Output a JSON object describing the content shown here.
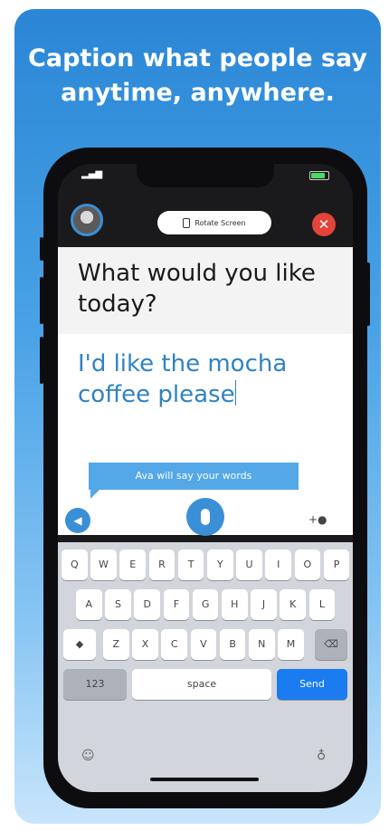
{
  "headline": {
    "line1": "Caption what people say",
    "line2": "anytime, anywhere."
  },
  "app": {
    "rotate_label": "Rotate Screen",
    "close_label": "✕",
    "question_text": "What would you like today?",
    "answer_text": "I'd like the mocha coffee please",
    "tooltip": "Ava will say your words"
  },
  "keyboard": {
    "row1": [
      "Q",
      "W",
      "E",
      "R",
      "T",
      "Y",
      "U",
      "I",
      "O",
      "P"
    ],
    "row2": [
      "A",
      "S",
      "D",
      "F",
      "G",
      "H",
      "J",
      "K",
      "L"
    ],
    "row3": [
      "Z",
      "X",
      "C",
      "V",
      "B",
      "N",
      "M"
    ],
    "numbers_label": "123",
    "space_label": "space",
    "send_label": "Send"
  },
  "icons": {
    "shift": "shift-icon",
    "backspace": "backspace-icon",
    "emoji": "emoji-icon",
    "dictation": "microphone-icon",
    "speaker": "speaker-icon",
    "add_user": "add-user-icon"
  },
  "colors": {
    "accent": "#3b8fd6",
    "answer_text": "#2f82c4",
    "close": "#e2443b",
    "send": "#1a7cf0"
  }
}
